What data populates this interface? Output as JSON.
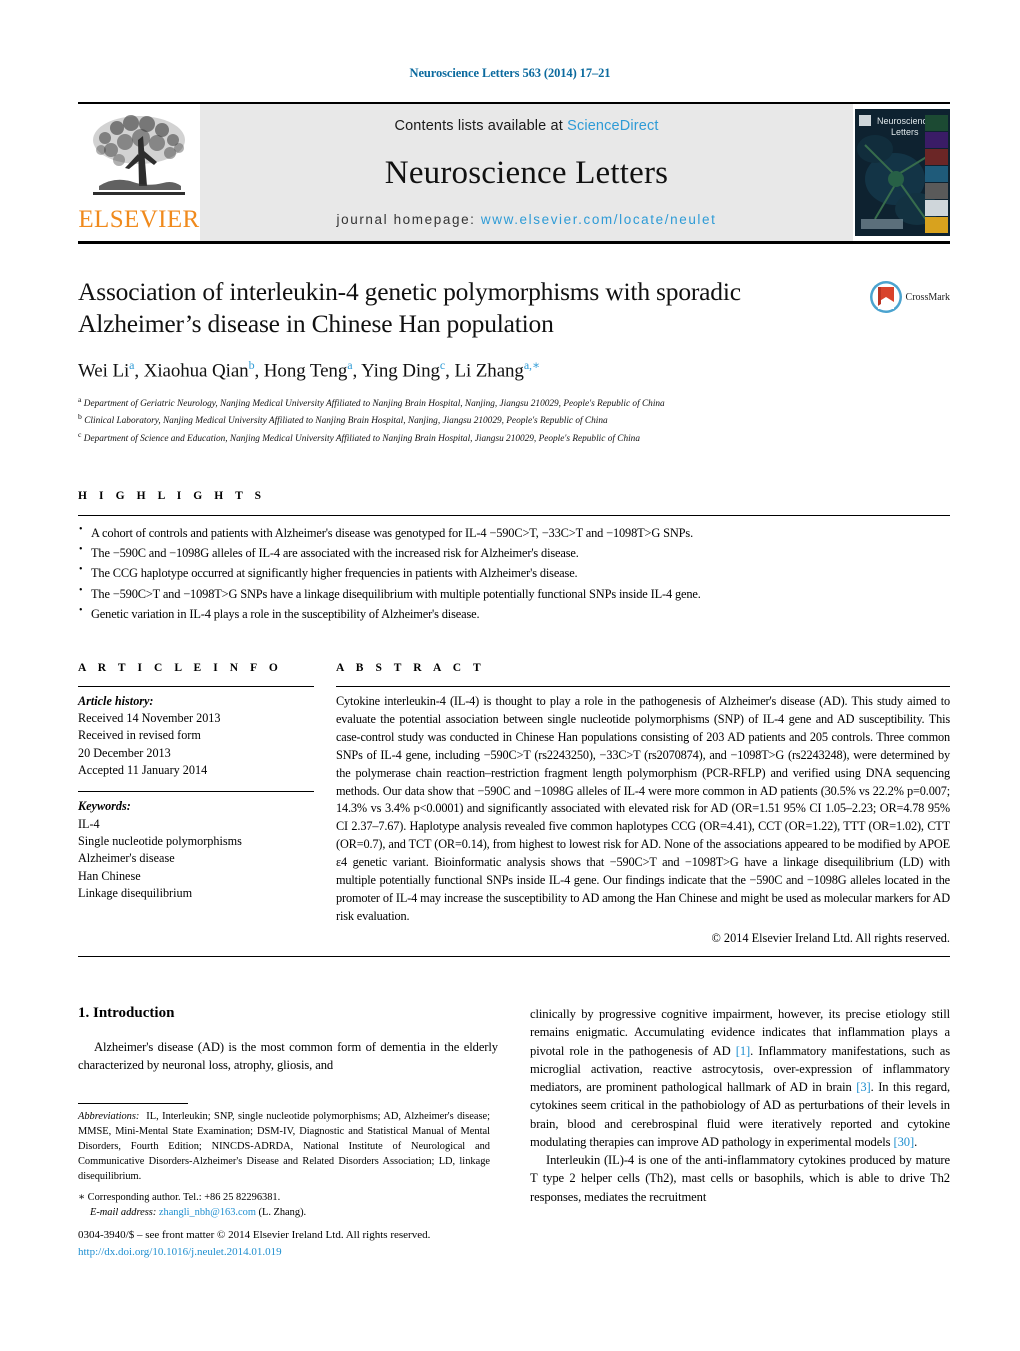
{
  "running_head": "Neuroscience Letters 563 (2014) 17–21",
  "masthead": {
    "publisher_name": "ELSEVIER",
    "contents_prefix": "Contents lists available at ",
    "contents_link": "ScienceDirect",
    "journal_title": "Neuroscience Letters",
    "homepage_prefix": "journal homepage: ",
    "homepage_link": "www.elsevier.com/locate/neulet",
    "cover_title_line1": "Neuroscience",
    "cover_title_line2": "Letters",
    "link_color": "#2e9bd6",
    "elsevier_orange": "#f08a1c"
  },
  "article": {
    "title": "Association of interleukin-4 genetic polymorphisms with sporadic Alzheimer’s disease in Chinese Han population",
    "authors": [
      {
        "name": "Wei Li",
        "sup": "a"
      },
      {
        "name": "Xiaohua Qian",
        "sup": "b"
      },
      {
        "name": "Hong Teng",
        "sup": "a"
      },
      {
        "name": "Ying Ding",
        "sup": "c"
      },
      {
        "name": "Li Zhang",
        "sup": "a,∗"
      }
    ],
    "affiliations": [
      {
        "sup": "a",
        "text": "Department of Geriatric Neurology, Nanjing Medical University Affiliated to Nanjing Brain Hospital, Nanjing, Jiangsu 210029, People's Republic of China"
      },
      {
        "sup": "b",
        "text": "Clinical Laboratory, Nanjing Medical University Affiliated to Nanjing Brain Hospital, Nanjing, Jiangsu 210029, People's Republic of China"
      },
      {
        "sup": "c",
        "text": "Department of Science and Education, Nanjing Medical University Affiliated to Nanjing Brain Hospital, Jiangsu 210029, People's Republic of China"
      }
    ],
    "crossmark_label": "CrossMark"
  },
  "highlights": {
    "heading": "H I G H L I G H T S",
    "items": [
      "A cohort of controls and patients with Alzheimer's disease was genotyped for IL-4 −590C>T, −33C>T and −1098T>G SNPs.",
      "The −590C and −1098G alleles of IL-4 are associated with the increased risk for Alzheimer's disease.",
      "The CCG haplotype occurred at significantly higher frequencies in patients with Alzheimer's disease.",
      "The −590C>T and −1098T>G SNPs have a linkage disequilibrium with multiple potentially functional SNPs inside IL-4 gene.",
      "Genetic variation in IL-4 plays a role in the susceptibility of Alzheimer's disease."
    ]
  },
  "article_info": {
    "heading": "A R T I C L E    I N F O",
    "history_label": "Article history:",
    "history": [
      "Received 14 November 2013",
      "Received in revised form",
      "20 December 2013",
      "Accepted 11 January 2014"
    ],
    "keywords_label": "Keywords:",
    "keywords": [
      "IL-4",
      "Single nucleotide polymorphisms",
      "Alzheimer's disease",
      "Han Chinese",
      "Linkage disequilibrium"
    ]
  },
  "abstract": {
    "heading": "A B S T R A C T",
    "text": "Cytokine interleukin-4 (IL-4) is thought to play a role in the pathogenesis of Alzheimer's disease (AD). This study aimed to evaluate the potential association between single nucleotide polymorphisms (SNP) of IL-4 gene and AD susceptibility. This case-control study was conducted in Chinese Han populations consisting of 203 AD patients and 205 controls. Three common SNPs of IL-4 gene, including −590C>T (rs2243250), −33C>T (rs2070874), and −1098T>G (rs2243248), were determined by the polymerase chain reaction–restriction fragment length polymorphism (PCR-RFLP) and verified using DNA sequencing methods. Our data show that −590C and −1098G alleles of IL-4 were more common in AD patients (30.5% vs 22.2% p=0.007; 14.3% vs 3.4% p<0.0001) and significantly associated with elevated risk for AD (OR=1.51 95% CI 1.05–2.23; OR=4.78 95% CI 2.37–7.67). Haplotype analysis revealed five common haplotypes CCG (OR=4.41), CCT (OR=1.22), TTT (OR=1.02), CTT (OR=0.7), and TCT (OR=0.14), from highest to lowest risk for AD. None of the associations appeared to be modified by APOE ε4 genetic variant. Bioinformatic analysis shows that −590C>T and −1098T>G have a linkage disequilibrium (LD) with multiple potentially functional SNPs inside IL-4 gene. Our findings indicate that the −590C and −1098G alleles located in the promoter of IL-4 may increase the susceptibility to AD among the Han Chinese and might be used as molecular markers for AD risk evaluation.",
    "copyright": "© 2014 Elsevier Ireland Ltd. All rights reserved."
  },
  "body": {
    "section_number_title": "1.  Introduction",
    "left_paragraph": "Alzheimer's disease (AD) is the most common form of dementia in the elderly characterized by neuronal loss, atrophy, gliosis, and",
    "right_paragraph_1_a": "clinically by progressive cognitive impairment, however, its precise etiology still remains enigmatic. Accumulating evidence indicates that inflammation plays a pivotal role in the pathogenesis of AD ",
    "right_ref_1": "[1]",
    "right_paragraph_1_b": ". Inflammatory manifestations, such as microglial activation, reactive astrocytosis, over-expression of inflammatory mediators, are prominent pathological hallmark of AD in brain ",
    "right_ref_2": "[3]",
    "right_paragraph_1_c": ". In this regard, cytokines seem critical in the pathobiology of AD as perturbations of their levels in brain, blood and cerebrospinal fluid were iteratively reported and cytokine modulating therapies can improve AD pathology in experimental models ",
    "right_ref_3": "[30]",
    "right_paragraph_1_d": ".",
    "right_paragraph_2": "Interleukin (IL)-4 is one of the anti-inflammatory cytokines produced by mature T type 2 helper cells (Th2), mast cells or basophils, which is able to drive Th2 responses, mediates the recruitment"
  },
  "footnotes": {
    "abbreviations_label": "Abbreviations:",
    "abbreviations_text": "IL, Interleukin; SNP, single nucleotide polymorphisms; AD, Alzheimer's disease; MMSE, Mini-Mental State Examination; DSM-IV, Diagnostic and Statistical Manual of Mental Disorders, Fourth Edition; NINCDS-ADRDA, National Institute of Neurological and Communicative Disorders-Alzheimer's Disease and Related Disorders Association; LD, linkage disequilibrium.",
    "corresponding_author": "∗ Corresponding author. Tel.: +86 25 82296381.",
    "email_label": "E-mail address:",
    "email": "zhangli_nbh@163.com",
    "email_suffix": "(L. Zhang).",
    "issn_line": "0304-3940/$ – see front matter © 2014 Elsevier Ireland Ltd. All rights reserved.",
    "doi_link": "http://dx.doi.org/10.1016/j.neulet.2014.01.019"
  }
}
